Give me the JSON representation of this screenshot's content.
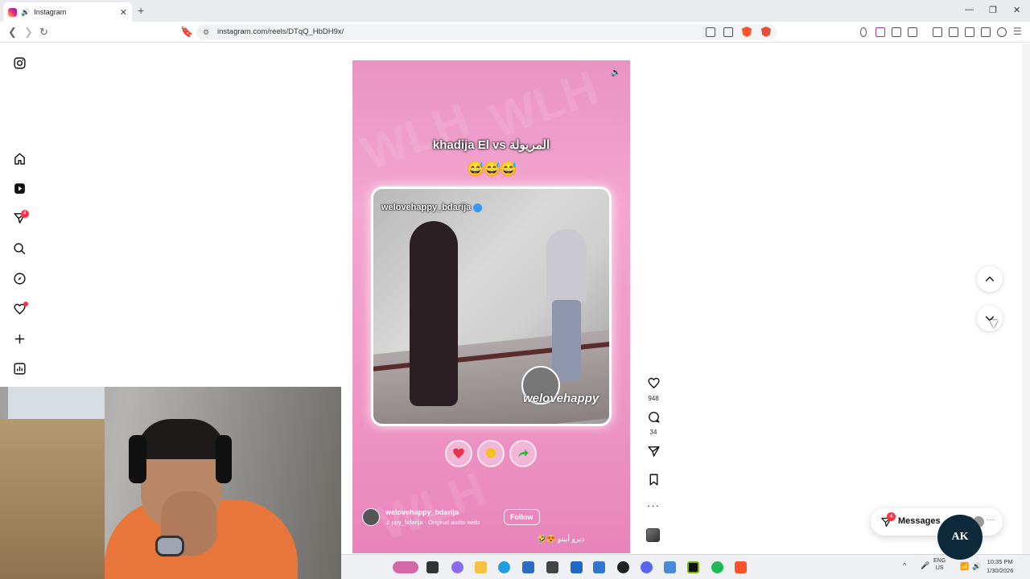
{
  "browser": {
    "tab_title": "Instagram",
    "url": "instagram.com/reels/DTqQ_HbDH9x/"
  },
  "sidebar": {
    "notifications_badge": "4"
  },
  "reel": {
    "caption": "khadija El vs المريولة",
    "caption_emojis": "😅😅😅",
    "video_handle": "welovehappy_bdarija",
    "video_logo_text": "welovehappy",
    "username": "welovehappy_bdarija",
    "audio": "ppy_bdarija · Original audio  welo",
    "follow_label": "Follow",
    "description": "🤣😍 ديرو أبيتو"
  },
  "actions": {
    "likes": "948",
    "comments": "34"
  },
  "messages": {
    "label": "Messages",
    "badge": "4"
  },
  "webcam": {
    "logo_text": "AK"
  },
  "taskbar": {
    "lang_top": "ENG",
    "lang_bottom": "US",
    "time": "10:35 PM",
    "date": "1/30/2026"
  }
}
